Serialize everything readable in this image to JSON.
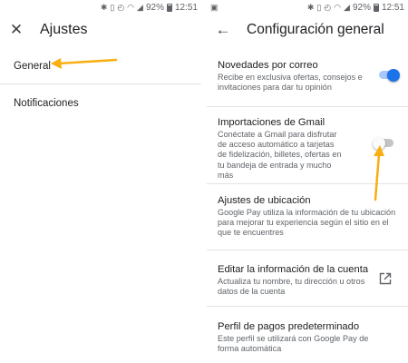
{
  "status": {
    "battery": "92%",
    "time": "12:51"
  },
  "left": {
    "title": "Ajustes",
    "items": [
      {
        "label": "General"
      },
      {
        "label": "Notificaciones"
      }
    ]
  },
  "right": {
    "title": "Configuración general",
    "settings": [
      {
        "title": "Novedades por correo",
        "description": "Recibe en exclusiva ofertas, consejos e invitaciones para dar tu opinión",
        "toggle": "on"
      },
      {
        "title": "Importaciones de Gmail",
        "description": "Conéctate a Gmail para disfrutar de acceso automático a tarjetas de fidelización, billetes, ofertas en tu bandeja de entrada y mucho más",
        "toggle": "off"
      },
      {
        "title": "Ajustes de ubicación",
        "description": "Google Pay utiliza la información de tu ubicación para mejorar tu experiencia según el sitio en el que te encuentres"
      },
      {
        "title": "Editar la información de la cuenta",
        "description": "Actualiza tu nombre, tu dirección u otros datos de la cuenta",
        "icon": "open-in-new-icon"
      },
      {
        "title": "Perfil de pagos predeterminado",
        "description": "Este perfil se utilizará con Google Pay de forma automática"
      }
    ]
  },
  "colors": {
    "accent": "#1a73e8",
    "annotation_arrow": "#f9ae12"
  }
}
